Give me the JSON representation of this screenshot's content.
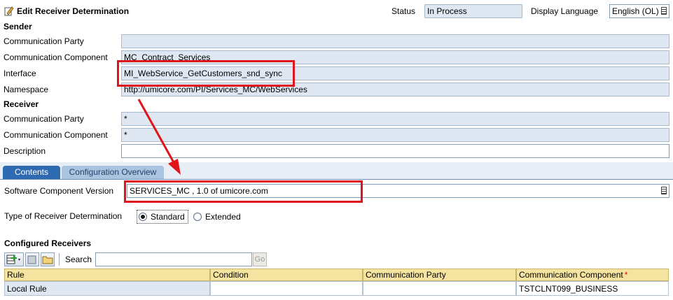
{
  "header": {
    "title": "Edit Receiver Determination",
    "status_label": "Status",
    "status_value": "In Process",
    "display_language_label": "Display Language",
    "display_language_value": "English (OL)"
  },
  "sender": {
    "section": "Sender",
    "communication_party_label": "Communication Party",
    "communication_party_value": "",
    "communication_component_label": "Communication Component",
    "communication_component_value": "MC_Contract_Services",
    "interface_label": "Interface",
    "interface_value": "MI_WebService_GetCustomers_snd_sync",
    "namespace_label": "Namespace",
    "namespace_value": "http://umicore.com/PI/Services_MC/WebServices"
  },
  "receiver": {
    "section": "Receiver",
    "communication_party_label": "Communication Party",
    "communication_party_value": "*",
    "communication_component_label": "Communication Component",
    "communication_component_value": "*"
  },
  "description": {
    "label": "Description",
    "value": ""
  },
  "tabs": [
    {
      "label": "Contents",
      "active": true
    },
    {
      "label": "Configuration Overview",
      "active": false
    }
  ],
  "contents": {
    "software_component_version_label": "Software Component Version",
    "software_component_version_value": "SERVICES_MC , 1.0 of umicore.com",
    "type_label": "Type of Receiver Determination",
    "type_options": [
      "Standard",
      "Extended"
    ],
    "type_selected": "Standard",
    "configured_receivers_label": "Configured Receivers",
    "search_label": "Search",
    "search_value": "",
    "go_label": "Go",
    "table": {
      "columns": [
        "Rule",
        "Condition",
        "Communication Party",
        "Communication Component"
      ],
      "required_marker": "*",
      "rows": [
        [
          "Local Rule",
          "",
          "",
          "TSTCLNT099_BUSINESS"
        ]
      ]
    }
  },
  "colors": {
    "highlight": "#e0141b",
    "field_bg": "#dfe8f2",
    "tab_active": "#2e6ab1",
    "table_header": "#f5e3a0"
  }
}
